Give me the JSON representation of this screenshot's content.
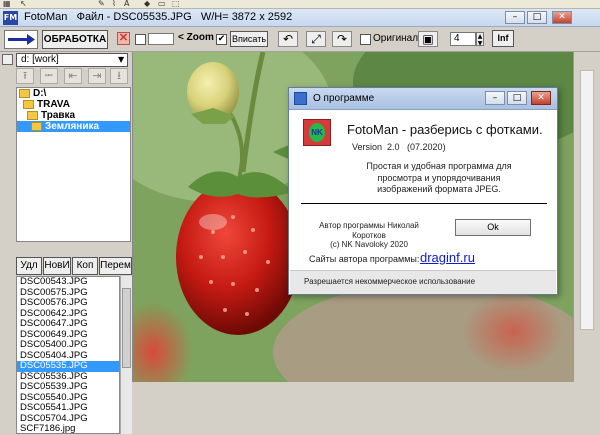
{
  "window": {
    "title": "FotoMan   Файл - DSC05535.JPG   W/H= 3872 x 2592",
    "app_icon": "fotoman-app-icon",
    "controls": [
      "minimize",
      "maximize",
      "close"
    ]
  },
  "toolbar": {
    "process_label": "ОБРАБОТКА",
    "zoom_label": "< Zoom",
    "fit_label": "Вписать",
    "original_label": "Оригинал",
    "count_value": "4",
    "info_label": "Inf"
  },
  "left_panel": {
    "drive_value": "d: [work]",
    "tree": [
      {
        "label": "D:\\",
        "selected": false
      },
      {
        "label": "TRAVA",
        "selected": false
      },
      {
        "label": "Травка",
        "selected": false
      },
      {
        "label": "Земляника",
        "selected": true
      }
    ],
    "buttons": [
      "Удл",
      "НовИ",
      "Коп",
      "Перем"
    ],
    "files": [
      "DSC00543.JPG",
      "DSC00575.JPG",
      "DSC00576.JPG",
      "DSC00642.JPG",
      "DSC00647.JPG",
      "DSC00649.JPG",
      "DSC05400.JPG",
      "DSC05404.JPG",
      "DSC05535.JPG",
      "DSC05536.JPG",
      "DSC05539.JPG",
      "DSC05540.JPG",
      "DSC05541.JPG",
      "DSC05704.JPG",
      "SCF7186.jpg"
    ],
    "selected_file": "DSC05535.JPG"
  },
  "about_dialog": {
    "title": "О программе",
    "logo_text": "NK",
    "heading": "FotoMan - разберись с фотками.",
    "version": "Version  2.0   (07.2020)",
    "description": "Простая и удобная программа для просмотра и упорядочивания изображений формата JPEG.",
    "author_line1": "Автор программы Николай Коротков",
    "author_line2": "(c)  NK Navoloky 2020",
    "ok_label": "Ok",
    "sites_label": "Сайты автора программы:",
    "site_link": "draginf.ru",
    "footer": "Разрешается некоммерческое использование"
  },
  "colors": {
    "selection": "#3399ff",
    "link": "#0c1bcf",
    "berry_red": "#c41a12",
    "leaf_green": "#5a8e3c"
  }
}
